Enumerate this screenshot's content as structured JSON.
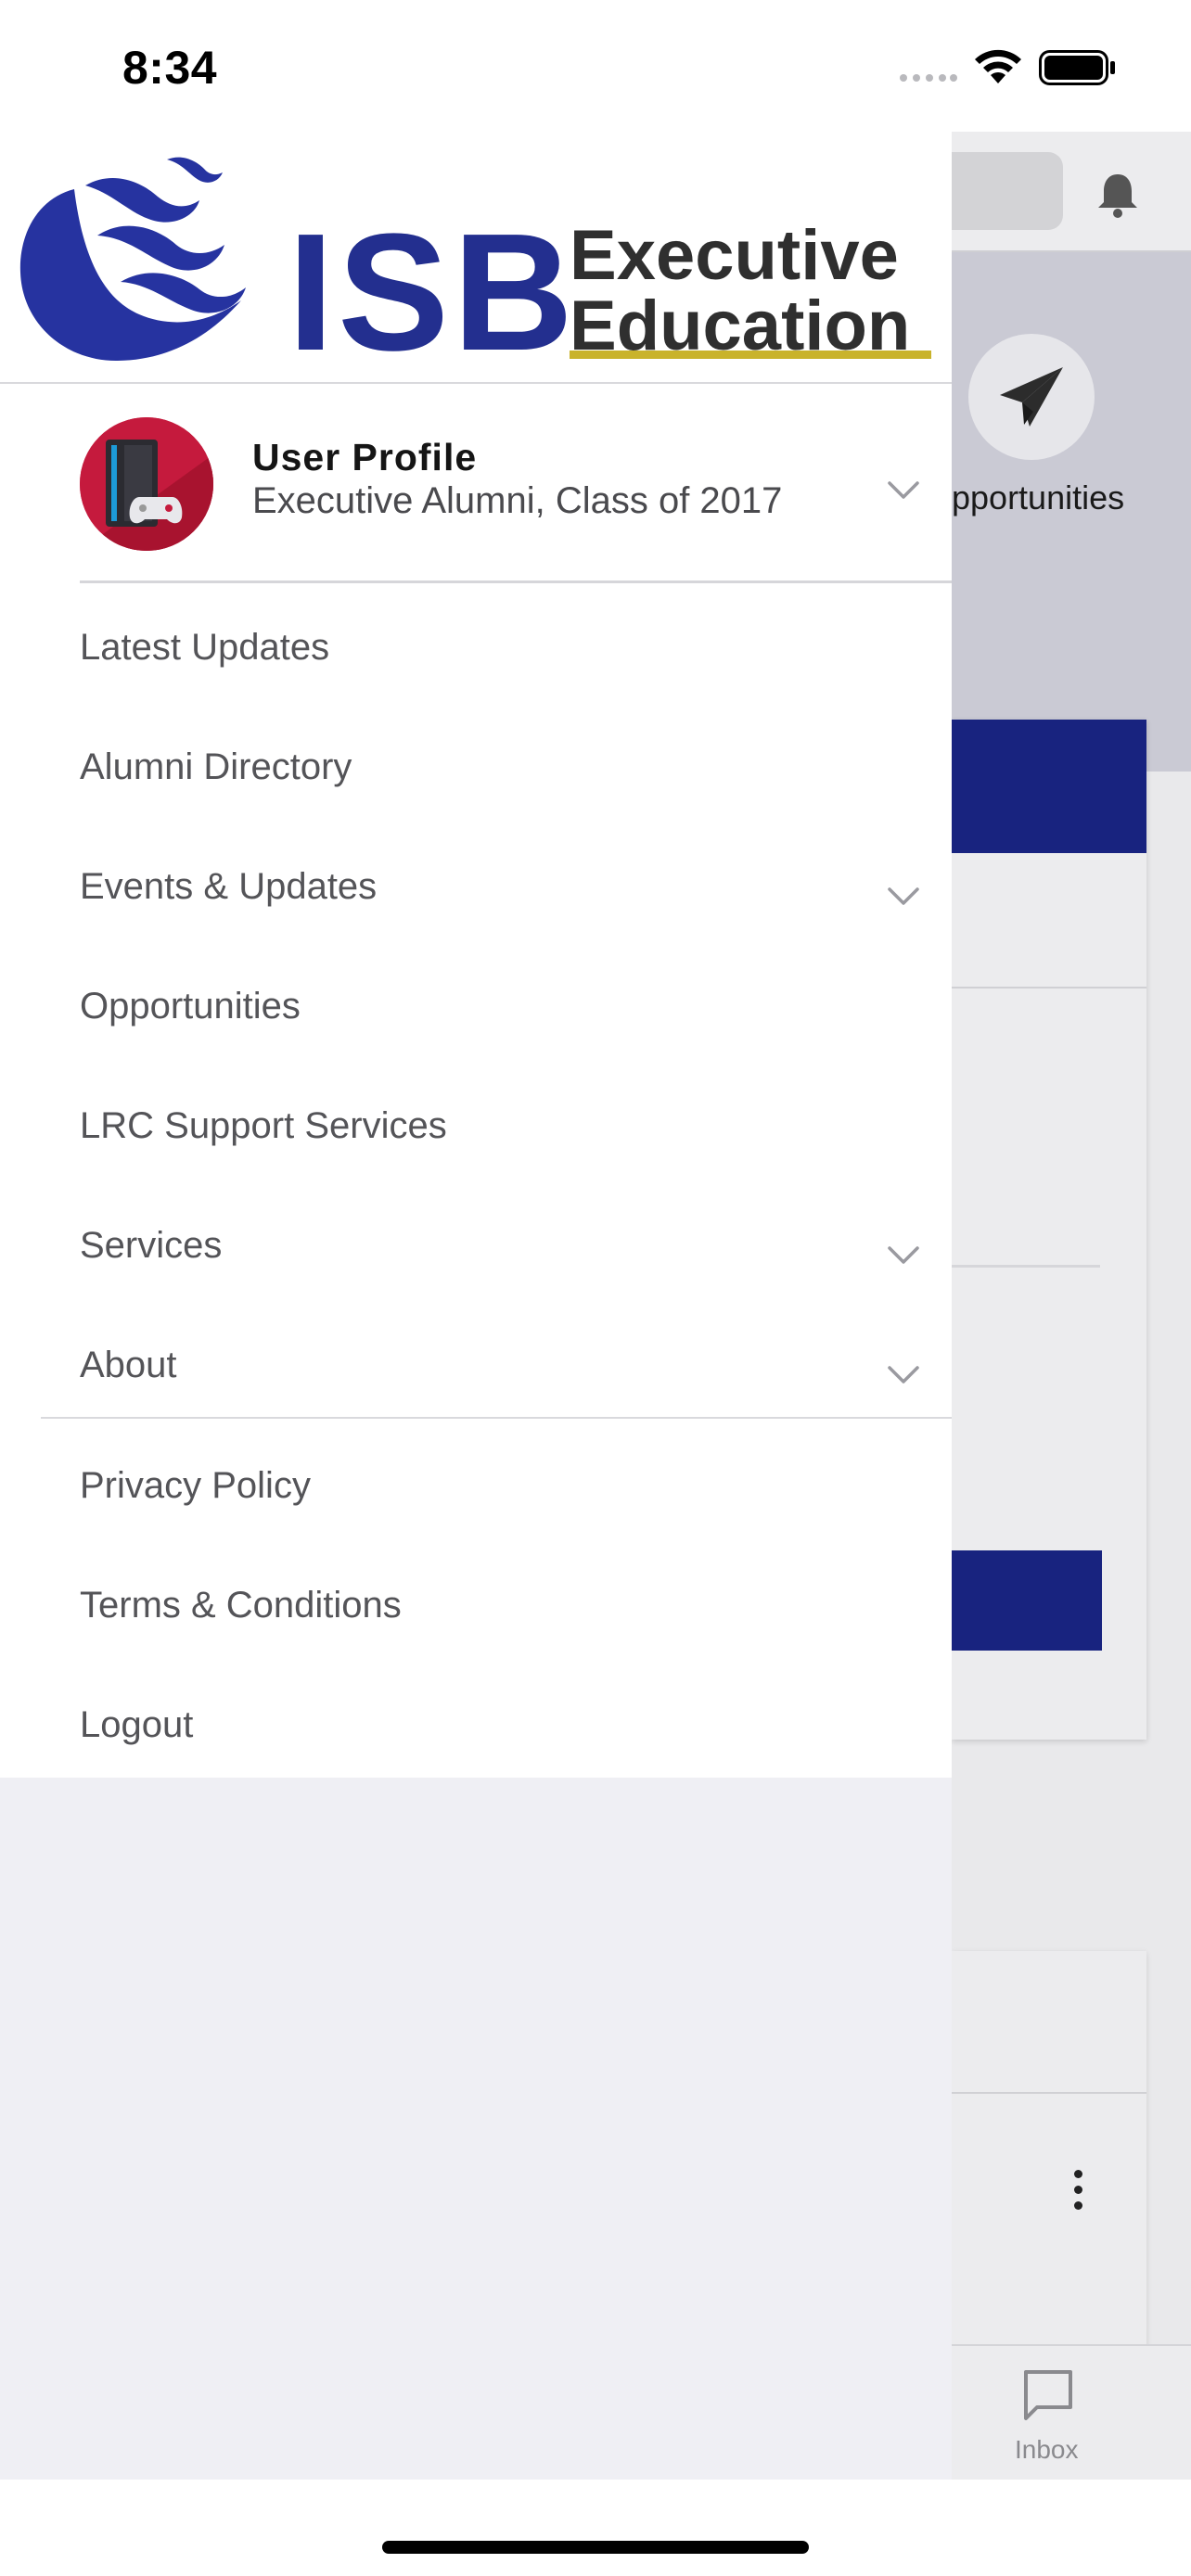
{
  "status_bar": {
    "time": "8:34",
    "icons": [
      "signal-dots-icon",
      "wifi-icon",
      "battery-icon"
    ]
  },
  "background_screen": {
    "header_icon": "bell-icon",
    "hero_icon": "paper-plane-icon",
    "hero_label": "Opportunities",
    "hero_label_visible": "pportunities",
    "tab_bar": {
      "inbox_icon": "chat-bubble-icon",
      "inbox_label": "Inbox"
    }
  },
  "drawer": {
    "logo": {
      "brand": "ISB",
      "line1": "Executive",
      "line2": "Education",
      "colors": {
        "brand_blue": "#232f8f",
        "underline_gold": "#c9b32b",
        "text_dark": "#2f2f2f"
      }
    },
    "profile": {
      "name": "User Profile",
      "subtitle": "Executive Alumni, Class of 2017",
      "avatar_icon": "game-console-avatar-icon",
      "expand_icon": "chevron-down-icon"
    },
    "menu_items": [
      {
        "label": "Latest Updates",
        "has_chevron": false
      },
      {
        "label": "Alumni Directory",
        "has_chevron": false
      },
      {
        "label": "Events & Updates",
        "has_chevron": true
      },
      {
        "label": "Opportunities",
        "has_chevron": false
      },
      {
        "label": "LRC Support Services",
        "has_chevron": false
      },
      {
        "label": "Services",
        "has_chevron": true
      },
      {
        "label": "About",
        "has_chevron": true
      },
      {
        "label": "Privacy Policy",
        "has_chevron": false
      },
      {
        "label": "Terms & Conditions",
        "has_chevron": false
      },
      {
        "label": "Logout",
        "has_chevron": false
      }
    ]
  },
  "colors": {
    "accent_blue": "#18237f",
    "menu_text": "#545458",
    "drawer_background": "#ffffff",
    "lower_background": "#efeff4"
  }
}
